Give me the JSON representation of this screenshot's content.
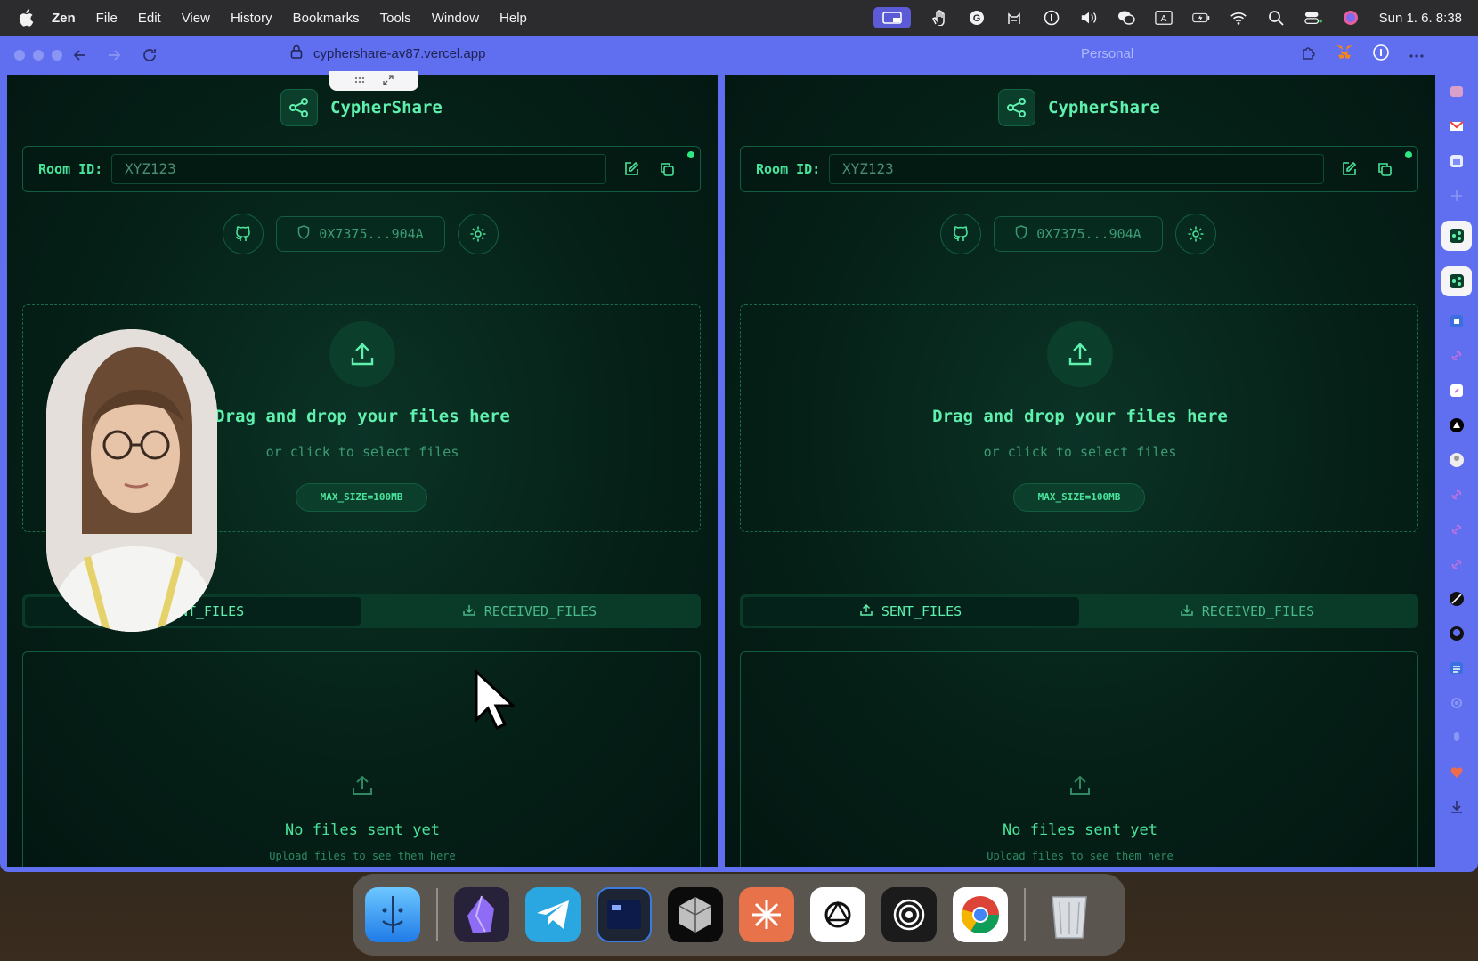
{
  "menubar": {
    "app_name": "Zen",
    "items": [
      "File",
      "Edit",
      "View",
      "History",
      "Bookmarks",
      "Tools",
      "Window",
      "Help"
    ],
    "clock": "Sun 1. 6.  8:38"
  },
  "browser": {
    "url": "cyphershare-av87.vercel.app",
    "profile": "Personal"
  },
  "panels": [
    {
      "brand": "CypherShare",
      "room_label": "Room ID:",
      "room_placeholder": "XYZ123",
      "address": "0X7375...904A",
      "dropzone_title": "Drag and drop your files here",
      "dropzone_sub": "or click to select files",
      "max_size": "MAX_SIZE=100MB",
      "tab_sent": "SENT_FILES",
      "tab_received": "RECEIVED_FILES",
      "empty_title": "No files sent yet",
      "empty_sub": "Upload files to see them here"
    },
    {
      "brand": "CypherShare",
      "room_label": "Room ID:",
      "room_placeholder": "XYZ123",
      "address": "0X7375...904A",
      "dropzone_title": "Drag and drop your files here",
      "dropzone_sub": "or click to select files",
      "max_size": "MAX_SIZE=100MB",
      "tab_sent": "SENT_FILES",
      "tab_received": "RECEIVED_FILES",
      "empty_title": "No files sent yet",
      "empty_sub": "Upload files to see them here"
    }
  ],
  "colors": {
    "accent": "#5ff0ae",
    "panel_bg": "#052017",
    "browser_frame": "#5f6ff0"
  },
  "dock": {
    "apps": [
      "finder-icon",
      "obsidian-icon",
      "telegram-icon",
      "terminal-icon",
      "cursor-app-icon",
      "claude-icon",
      "chatgpt-icon",
      "focus-icon",
      "chrome-icon",
      "trash-icon"
    ]
  }
}
